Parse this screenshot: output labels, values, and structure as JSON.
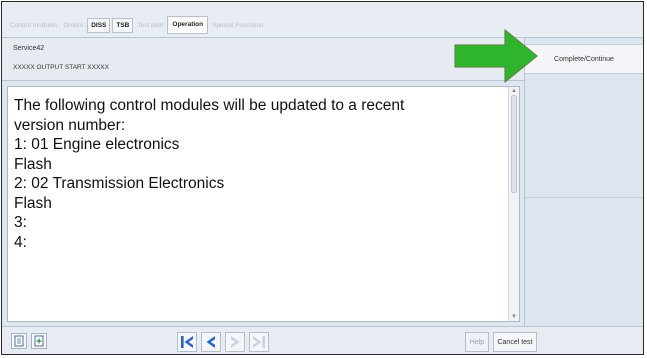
{
  "tabs": [
    {
      "label": "Control modules",
      "state": "disabled"
    },
    {
      "label": "Orders",
      "state": "disabled"
    },
    {
      "label": "DISS",
      "state": "enabled"
    },
    {
      "label": "TSB",
      "state": "enabled"
    },
    {
      "label": "Test plan",
      "state": "disabled"
    },
    {
      "label": "Operation",
      "state": "active"
    },
    {
      "label": "Special Functions",
      "state": "disabled"
    }
  ],
  "service": {
    "title": "Service42",
    "subtitle": "XXXXX OUTPUT START XXXXX"
  },
  "message": {
    "lines": [
      "The following control modules will be updated to a recent",
      "version number:",
      "",
      "1: 01 Engine electronics",
      "Flash",
      "2: 02 Transmission Electronics",
      "Flash",
      "3:",
      "",
      "4:"
    ]
  },
  "right_panel": {
    "complete_continue_label": "Complete/Continue"
  },
  "bottom_bar": {
    "help_label": "Help",
    "cancel_label": "Cancel test"
  },
  "colors": {
    "arrow_green": "#2fb52b",
    "nav_blue": "#2a63c9",
    "nav_disabled": "#c9d2de"
  },
  "icons": {
    "doc_left": "document-icon",
    "doc_right": "document-add-icon",
    "first": "skip-to-start-icon",
    "prev": "chevron-left-icon",
    "next": "chevron-right-icon",
    "last": "skip-to-end-icon",
    "arrow": "arrow-right-icon"
  }
}
